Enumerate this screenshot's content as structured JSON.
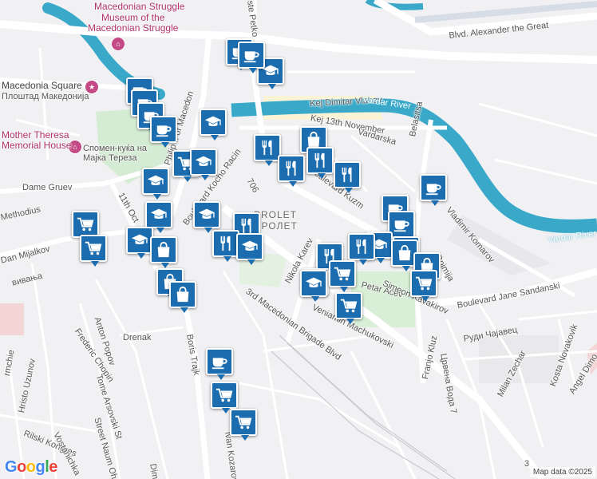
{
  "map": {
    "attribution": "Map data ©2025",
    "logo": "Google",
    "logo_colors": [
      "#4285F4",
      "#EA4335",
      "#FBBC05",
      "#4285F4",
      "#34A853",
      "#EA4335"
    ],
    "river_color": "#3aa9c9",
    "marker_color": "#1c6cb0"
  },
  "labels": {
    "museum_top": "Macedonian Struggle",
    "museum": "Museum of the\nMacedonian Struggle",
    "macedonia_square": "Macedonia Square",
    "macedonia_square_cyr": "Плоштад Македонија",
    "mother_teresa": "Mother Theresa\nMemorial House",
    "mother_teresa_cyr": "Спомен-куќа на\nМајка Тереза",
    "dame_gruev": "Dame Gruev",
    "methodius": "Methodius",
    "dan_mijalkov": "Dan Mijalkov",
    "vivanja": "вивања",
    "eleventh_oct": "11th Oct",
    "philip_ii": "Philip II of Macedon",
    "kocho_racin": "Boulevard Kocho Racin",
    "num_706": "706",
    "kej_vlahov": "Kej Dimitar Vlahov",
    "kej_13nov": "Kej 13th November",
    "vardarska": "Vardarska",
    "vardar_river": "Vardar River",
    "vardar_river_2": "Vardar River",
    "belasitsa": "Belasitsa",
    "blvd_alexander": "Blvd. Alexander the Great",
    "ste_petko": "ste Petko",
    "prolet": "PROLET",
    "prolet_cyr": "ПРОЛЕТ",
    "boulevard_kuzman": "Boulevard Kuzm",
    "vladimir_komarov": "Vladimir Komarov",
    "nikola_karev": "Nikola Karev",
    "petar_acev": "Petar Acev",
    "simeon_kavakirov": "Simeon Kavakirov",
    "bojmija": "Bojmija",
    "veniamin": "Veniamin Machukovski",
    "boulevard_jane": "Boulevard Jane Sandanski",
    "third_mac": "3rd Macedonian Brigade Blvd",
    "rudi_cajavec": "Руди Чајавец",
    "franjo_kluz": "Franjo Kluz",
    "cvrena_voda": "Црвена Вода 7",
    "milan_zechar": "Milan Zechar",
    "kosta_novakovik": "Kosta Novakovik",
    "angel_dimov": "Angel Dimo",
    "anton_popov": "Anton Popov",
    "drenak": "Drenak",
    "frederic_chopin": "Frederic Chopin",
    "tome_arsovski": "Tome Arsovski St",
    "street_naum": "Street Naum Ohridski",
    "boris_trajkovski": "Boris Trajk",
    "hristo_uzunov": "Hristo Uzunov",
    "rilski_kongres": "Rilski Kongres",
    "vostanichka": "Vostanichka",
    "ivan_kozarov": "Ivan Kozarov",
    "dimitar": "Dim",
    "mchie": "rmchie",
    "edge_3": "3"
  },
  "markers": [
    {
      "icon": "cafe"
    },
    {
      "icon": "school"
    },
    {
      "icon": "store"
    },
    {
      "icon": "cafe"
    },
    {
      "icon": "cafe"
    },
    {
      "icon": "cafe"
    },
    {
      "icon": "cafe"
    },
    {
      "icon": "school"
    },
    {
      "icon": "store"
    },
    {
      "icon": "school"
    },
    {
      "icon": "school"
    },
    {
      "icon": "restaurant"
    },
    {
      "icon": "shopping-bag"
    },
    {
      "icon": "restaurant"
    },
    {
      "icon": "restaurant"
    },
    {
      "icon": "restaurant"
    },
    {
      "icon": "school"
    },
    {
      "icon": "school"
    },
    {
      "icon": "restaurant"
    },
    {
      "icon": "restaurant"
    },
    {
      "icon": "school"
    },
    {
      "icon": "store"
    },
    {
      "icon": "store"
    },
    {
      "icon": "school"
    },
    {
      "icon": "shopping-bag"
    },
    {
      "icon": "shopping-bag"
    },
    {
      "icon": "shopping-bag"
    },
    {
      "icon": "cafe"
    },
    {
      "icon": "cafe"
    },
    {
      "icon": "cafe"
    },
    {
      "icon": "school"
    },
    {
      "icon": "cafe"
    },
    {
      "icon": "restaurant"
    },
    {
      "icon": "restaurant"
    },
    {
      "icon": "school"
    },
    {
      "icon": "store"
    },
    {
      "icon": "school"
    },
    {
      "icon": "shopping-bag"
    },
    {
      "icon": "shopping-bag"
    },
    {
      "icon": "store"
    },
    {
      "icon": "store"
    },
    {
      "icon": "cafe"
    },
    {
      "icon": "store"
    },
    {
      "icon": "store"
    }
  ]
}
